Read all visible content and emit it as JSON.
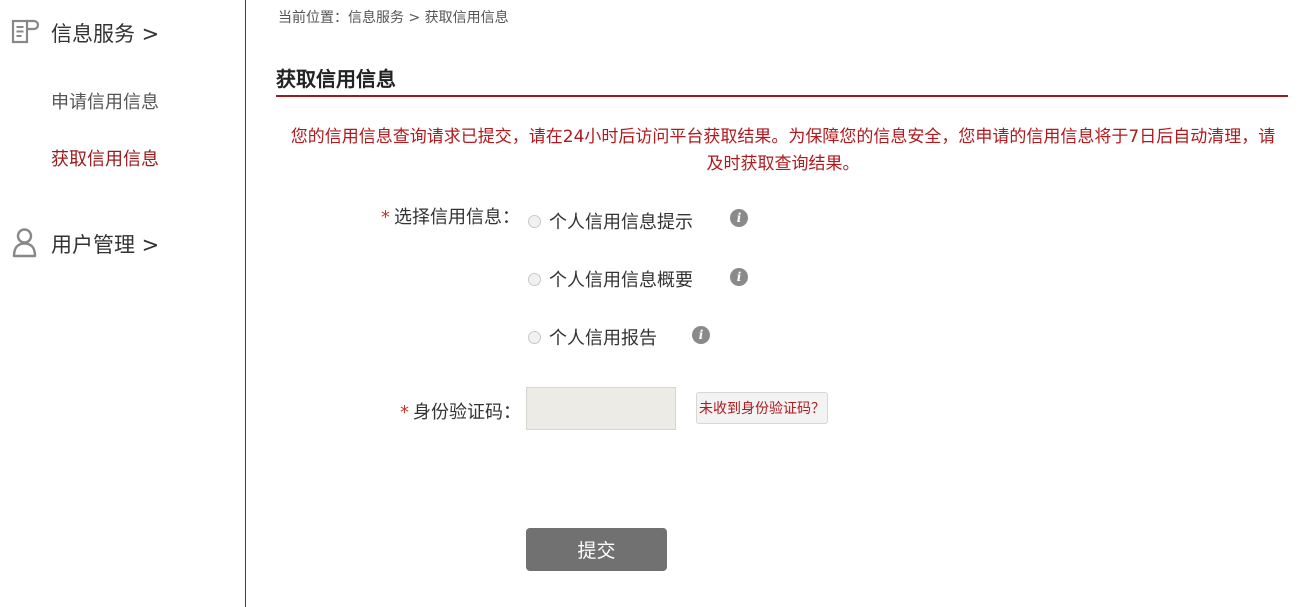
{
  "sidebar": {
    "sections": [
      {
        "label": "信息服务 >",
        "icon": "document-icon",
        "items": [
          {
            "label": "申请信用信息",
            "active": false
          },
          {
            "label": "获取信用信息",
            "active": true
          }
        ]
      },
      {
        "label": "用户管理 >",
        "icon": "user-icon"
      }
    ]
  },
  "breadcrumb": {
    "prefix": "当前位置：",
    "items": [
      "信息服务",
      "获取信用信息"
    ],
    "separator": " > "
  },
  "page": {
    "title": "获取信用信息",
    "notice": "您的信用信息查询请求已提交，请在24小时后访问平台获取结果。为保障您的信息安全，您申请的信用信息将于7日后自动清理，请及时获取查询结果。"
  },
  "form": {
    "required_mark": "*",
    "credit_label": "选择信用信息：",
    "options": [
      {
        "label": "个人信用信息提示",
        "selected": false
      },
      {
        "label": "个人信用信息概要",
        "selected": false
      },
      {
        "label": "个人信用报告",
        "selected": false
      }
    ],
    "info_icon_glyph": "i",
    "code_label": "身份验证码：",
    "code_value": "",
    "resend_label": "未收到身份验证码？",
    "submit_label": "提交"
  },
  "colors": {
    "accent": "#9b1b1b",
    "notice_text": "#b0191d",
    "submit_bg": "#717171",
    "input_bg": "#ecebe5"
  }
}
